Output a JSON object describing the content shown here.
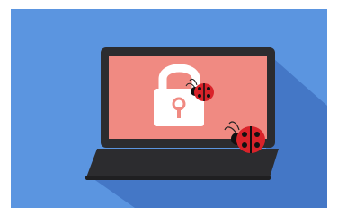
{
  "illustration": {
    "subject": "laptop-with-padlock-and-ladybug-bugs",
    "icons": [
      "laptop-icon",
      "padlock-icon",
      "ladybug-icon",
      "ladybug-icon"
    ]
  },
  "colors": {
    "background": "#5b95e0",
    "shadow": "#4477c6",
    "laptop_body": "#2c2c2f",
    "laptop_keyboard": "#222224",
    "screen": "#f08a82",
    "lock_white": "#ffffff",
    "lock_keyhole": "#f08a82",
    "ladybug_red": "#d9232a",
    "ladybug_black": "#111111"
  }
}
